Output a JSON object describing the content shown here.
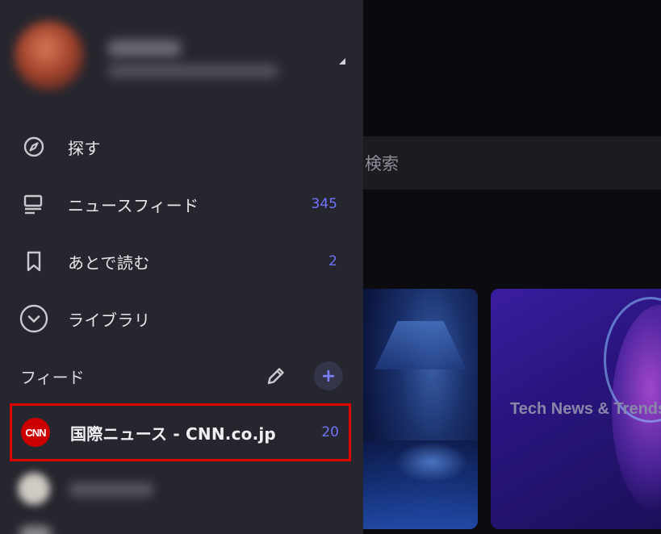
{
  "background": {
    "search_placeholder": "検索",
    "card_title": "Tech News & Trends"
  },
  "profile": {
    "name": "",
    "email": ""
  },
  "nav": {
    "items": [
      {
        "label": "探す",
        "icon": "compass-icon",
        "count": ""
      },
      {
        "label": "ニュースフィード",
        "icon": "feed-icon",
        "count": "345"
      },
      {
        "label": "あとで読む",
        "icon": "bookmark-icon",
        "count": "2"
      },
      {
        "label": "ライブラリ",
        "icon": "chevron-circle-icon",
        "count": ""
      }
    ]
  },
  "feeds": {
    "title": "フィード",
    "items": [
      {
        "label": "国際ニュース - CNN.co.jp",
        "logo_text": "CNN",
        "count": "20",
        "highlighted": true
      }
    ]
  },
  "colors": {
    "drawer_bg": "#26262e",
    "accent": "#6f74ff",
    "highlight_border": "#e00000",
    "cnn_red": "#cc0000"
  }
}
